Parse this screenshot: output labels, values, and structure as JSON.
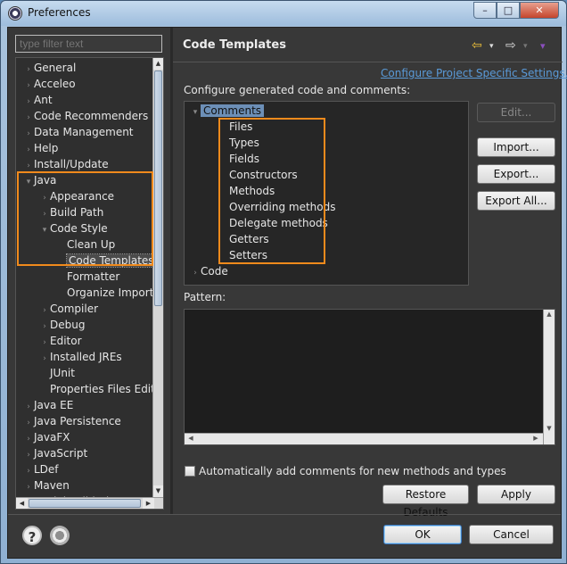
{
  "window": {
    "title": "Preferences",
    "controls": {
      "min": "–",
      "max": "□",
      "close": "✕"
    }
  },
  "filter": {
    "placeholder": "type filter text"
  },
  "tree": [
    {
      "label": "General",
      "level": 0,
      "exp": "›"
    },
    {
      "label": "Acceleo",
      "level": 0,
      "exp": "›"
    },
    {
      "label": "Ant",
      "level": 0,
      "exp": "›"
    },
    {
      "label": "Code Recommenders",
      "level": 0,
      "exp": "›"
    },
    {
      "label": "Data Management",
      "level": 0,
      "exp": "›"
    },
    {
      "label": "Help",
      "level": 0,
      "exp": "›"
    },
    {
      "label": "Install/Update",
      "level": 0,
      "exp": "›"
    },
    {
      "label": "Java",
      "level": 0,
      "exp": "▾"
    },
    {
      "label": "Appearance",
      "level": 1,
      "exp": "›"
    },
    {
      "label": "Build Path",
      "level": 1,
      "exp": "›"
    },
    {
      "label": "Code Style",
      "level": 1,
      "exp": "▾"
    },
    {
      "label": "Clean Up",
      "level": 2,
      "exp": ""
    },
    {
      "label": "Code Templates",
      "level": 2,
      "exp": "",
      "selected": true
    },
    {
      "label": "Formatter",
      "level": 2,
      "exp": ""
    },
    {
      "label": "Organize Imports",
      "level": 2,
      "exp": ""
    },
    {
      "label": "Compiler",
      "level": 1,
      "exp": "›"
    },
    {
      "label": "Debug",
      "level": 1,
      "exp": "›"
    },
    {
      "label": "Editor",
      "level": 1,
      "exp": "›"
    },
    {
      "label": "Installed JREs",
      "level": 1,
      "exp": "›"
    },
    {
      "label": "JUnit",
      "level": 1,
      "exp": ""
    },
    {
      "label": "Properties Files Editor",
      "level": 1,
      "exp": ""
    },
    {
      "label": "Java EE",
      "level": 0,
      "exp": "›"
    },
    {
      "label": "Java Persistence",
      "level": 0,
      "exp": "›"
    },
    {
      "label": "JavaFX",
      "level": 0,
      "exp": "›"
    },
    {
      "label": "JavaScript",
      "level": 0,
      "exp": "›"
    },
    {
      "label": "LDef",
      "level": 0,
      "exp": "›"
    },
    {
      "label": "Maven",
      "level": 0,
      "exp": "›"
    },
    {
      "label": "Model Validation",
      "level": 0,
      "exp": "›"
    }
  ],
  "page": {
    "title": "Code Templates",
    "nav": {
      "back": "⇦",
      "back_menu": "▾",
      "forward": "⇨",
      "forward_menu": "▾",
      "menu": "▾"
    },
    "config_link": "Configure Project Specific Settings...",
    "description": "Configure generated code and comments:",
    "templates": [
      {
        "label": "Comments",
        "level": 0,
        "exp": "▾",
        "selected": true
      },
      {
        "label": "Files",
        "level": 1,
        "exp": ""
      },
      {
        "label": "Types",
        "level": 1,
        "exp": ""
      },
      {
        "label": "Fields",
        "level": 1,
        "exp": ""
      },
      {
        "label": "Constructors",
        "level": 1,
        "exp": ""
      },
      {
        "label": "Methods",
        "level": 1,
        "exp": ""
      },
      {
        "label": "Overriding methods",
        "level": 1,
        "exp": ""
      },
      {
        "label": "Delegate methods",
        "level": 1,
        "exp": ""
      },
      {
        "label": "Getters",
        "level": 1,
        "exp": ""
      },
      {
        "label": "Setters",
        "level": 1,
        "exp": ""
      },
      {
        "label": "Code",
        "level": 0,
        "exp": "›"
      }
    ],
    "buttons": {
      "edit": "Edit...",
      "import": "Import...",
      "export": "Export...",
      "export_all": "Export All..."
    },
    "pattern_label": "Pattern:",
    "auto_comments": {
      "label": "Automatically add comments for new methods and types",
      "checked": false
    },
    "restore_defaults": "Restore Defaults",
    "apply": "Apply"
  },
  "footer": {
    "help_icon": "?",
    "ok": "OK",
    "cancel": "Cancel"
  },
  "colors": {
    "highlight": "#f08a1c",
    "link": "#5a9ad8",
    "selection": "#6c8fb7"
  }
}
